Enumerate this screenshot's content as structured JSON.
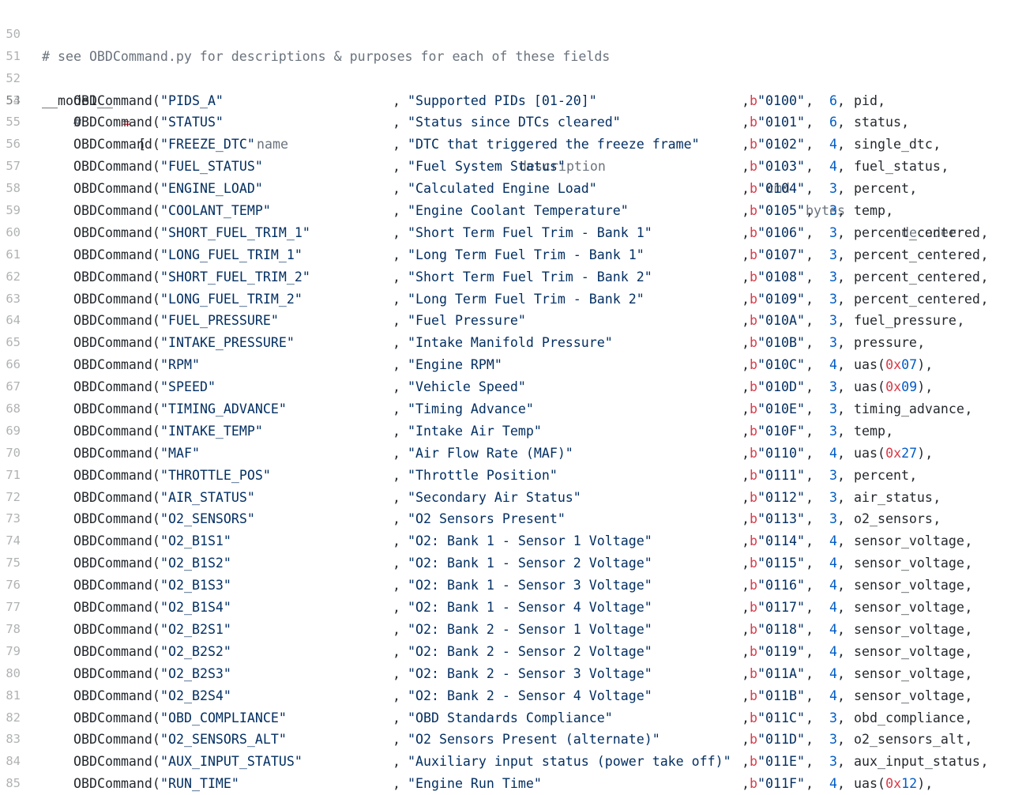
{
  "colors": {
    "comment": "#6a737d",
    "string": "#032f62",
    "number": "#005cc5",
    "keyword": "#d73a49",
    "text": "#24292e",
    "line_number": "#bbbbbb"
  },
  "header_lines": [
    {
      "num": "50",
      "text": "# see OBDCommand.py for descriptions & purposes for each of these fields"
    },
    {
      "num": "51",
      "text": ""
    },
    {
      "num": "52",
      "var": "__mode1__",
      "op": "=",
      "bracket": "["
    }
  ],
  "column_header": {
    "num": "53",
    "hash": "#",
    "name": "name",
    "description": "description",
    "cmd": "cmd",
    "bytes": "bytes",
    "decoder": "decoder"
  },
  "rows": [
    {
      "num": "54",
      "cls": "OBDCommand(",
      "name": "\"PIDS_A\"",
      "desc": "\"Supported PIDs [01-20]\"",
      "b": "b",
      "cmd": "\"0100\"",
      "bytes": "6",
      "dec": "pid",
      "dec_arg": "",
      "tail": ","
    },
    {
      "num": "55",
      "cls": "OBDCommand(",
      "name": "\"STATUS\"",
      "desc": "\"Status since DTCs cleared\"",
      "b": "b",
      "cmd": "\"0101\"",
      "bytes": "6",
      "dec": "status",
      "dec_arg": "",
      "tail": ","
    },
    {
      "num": "56",
      "cls": "OBDCommand(",
      "name": "\"FREEZE_DTC\"",
      "desc": "\"DTC that triggered the freeze frame\"",
      "b": "b",
      "cmd": "\"0102\"",
      "bytes": "4",
      "dec": "single_dtc",
      "dec_arg": "",
      "tail": ","
    },
    {
      "num": "57",
      "cls": "OBDCommand(",
      "name": "\"FUEL_STATUS\"",
      "desc": "\"Fuel System Status\"",
      "b": "b",
      "cmd": "\"0103\"",
      "bytes": "4",
      "dec": "fuel_status",
      "dec_arg": "",
      "tail": ","
    },
    {
      "num": "58",
      "cls": "OBDCommand(",
      "name": "\"ENGINE_LOAD\"",
      "desc": "\"Calculated Engine Load\"",
      "b": "b",
      "cmd": "\"0104\"",
      "bytes": "3",
      "dec": "percent",
      "dec_arg": "",
      "tail": ","
    },
    {
      "num": "59",
      "cls": "OBDCommand(",
      "name": "\"COOLANT_TEMP\"",
      "desc": "\"Engine Coolant Temperature\"",
      "b": "b",
      "cmd": "\"0105\"",
      "bytes": "3",
      "dec": "temp",
      "dec_arg": "",
      "tail": ","
    },
    {
      "num": "60",
      "cls": "OBDCommand(",
      "name": "\"SHORT_FUEL_TRIM_1\"",
      "desc": "\"Short Term Fuel Trim - Bank 1\"",
      "b": "b",
      "cmd": "\"0106\"",
      "bytes": "3",
      "dec": "percent_centered",
      "dec_arg": "",
      "tail": ","
    },
    {
      "num": "61",
      "cls": "OBDCommand(",
      "name": "\"LONG_FUEL_TRIM_1\"",
      "desc": "\"Long Term Fuel Trim - Bank 1\"",
      "b": "b",
      "cmd": "\"0107\"",
      "bytes": "3",
      "dec": "percent_centered",
      "dec_arg": "",
      "tail": ","
    },
    {
      "num": "62",
      "cls": "OBDCommand(",
      "name": "\"SHORT_FUEL_TRIM_2\"",
      "desc": "\"Short Term Fuel Trim - Bank 2\"",
      "b": "b",
      "cmd": "\"0108\"",
      "bytes": "3",
      "dec": "percent_centered",
      "dec_arg": "",
      "tail": ","
    },
    {
      "num": "63",
      "cls": "OBDCommand(",
      "name": "\"LONG_FUEL_TRIM_2\"",
      "desc": "\"Long Term Fuel Trim - Bank 2\"",
      "b": "b",
      "cmd": "\"0109\"",
      "bytes": "3",
      "dec": "percent_centered",
      "dec_arg": "",
      "tail": ","
    },
    {
      "num": "64",
      "cls": "OBDCommand(",
      "name": "\"FUEL_PRESSURE\"",
      "desc": "\"Fuel Pressure\"",
      "b": "b",
      "cmd": "\"010A\"",
      "bytes": "3",
      "dec": "fuel_pressure",
      "dec_arg": "",
      "tail": ","
    },
    {
      "num": "65",
      "cls": "OBDCommand(",
      "name": "\"INTAKE_PRESSURE\"",
      "desc": "\"Intake Manifold Pressure\"",
      "b": "b",
      "cmd": "\"010B\"",
      "bytes": "3",
      "dec": "pressure",
      "dec_arg": "",
      "tail": ","
    },
    {
      "num": "66",
      "cls": "OBDCommand(",
      "name": "\"RPM\"",
      "desc": "\"Engine RPM\"",
      "b": "b",
      "cmd": "\"010C\"",
      "bytes": "4",
      "dec": "uas(",
      "dec_arg": "07",
      "tail": "),"
    },
    {
      "num": "67",
      "cls": "OBDCommand(",
      "name": "\"SPEED\"",
      "desc": "\"Vehicle Speed\"",
      "b": "b",
      "cmd": "\"010D\"",
      "bytes": "3",
      "dec": "uas(",
      "dec_arg": "09",
      "tail": "),"
    },
    {
      "num": "68",
      "cls": "OBDCommand(",
      "name": "\"TIMING_ADVANCE\"",
      "desc": "\"Timing Advance\"",
      "b": "b",
      "cmd": "\"010E\"",
      "bytes": "3",
      "dec": "timing_advance",
      "dec_arg": "",
      "tail": ","
    },
    {
      "num": "69",
      "cls": "OBDCommand(",
      "name": "\"INTAKE_TEMP\"",
      "desc": "\"Intake Air Temp\"",
      "b": "b",
      "cmd": "\"010F\"",
      "bytes": "3",
      "dec": "temp",
      "dec_arg": "",
      "tail": ","
    },
    {
      "num": "70",
      "cls": "OBDCommand(",
      "name": "\"MAF\"",
      "desc": "\"Air Flow Rate (MAF)\"",
      "b": "b",
      "cmd": "\"0110\"",
      "bytes": "4",
      "dec": "uas(",
      "dec_arg": "27",
      "tail": "),"
    },
    {
      "num": "71",
      "cls": "OBDCommand(",
      "name": "\"THROTTLE_POS\"",
      "desc": "\"Throttle Position\"",
      "b": "b",
      "cmd": "\"0111\"",
      "bytes": "3",
      "dec": "percent",
      "dec_arg": "",
      "tail": ","
    },
    {
      "num": "72",
      "cls": "OBDCommand(",
      "name": "\"AIR_STATUS\"",
      "desc": "\"Secondary Air Status\"",
      "b": "b",
      "cmd": "\"0112\"",
      "bytes": "3",
      "dec": "air_status",
      "dec_arg": "",
      "tail": ","
    },
    {
      "num": "73",
      "cls": "OBDCommand(",
      "name": "\"O2_SENSORS\"",
      "desc": "\"O2 Sensors Present\"",
      "b": "b",
      "cmd": "\"0113\"",
      "bytes": "3",
      "dec": "o2_sensors",
      "dec_arg": "",
      "tail": ","
    },
    {
      "num": "74",
      "cls": "OBDCommand(",
      "name": "\"O2_B1S1\"",
      "desc": "\"O2: Bank 1 - Sensor 1 Voltage\"",
      "b": "b",
      "cmd": "\"0114\"",
      "bytes": "4",
      "dec": "sensor_voltage",
      "dec_arg": "",
      "tail": ","
    },
    {
      "num": "75",
      "cls": "OBDCommand(",
      "name": "\"O2_B1S2\"",
      "desc": "\"O2: Bank 1 - Sensor 2 Voltage\"",
      "b": "b",
      "cmd": "\"0115\"",
      "bytes": "4",
      "dec": "sensor_voltage",
      "dec_arg": "",
      "tail": ","
    },
    {
      "num": "76",
      "cls": "OBDCommand(",
      "name": "\"O2_B1S3\"",
      "desc": "\"O2: Bank 1 - Sensor 3 Voltage\"",
      "b": "b",
      "cmd": "\"0116\"",
      "bytes": "4",
      "dec": "sensor_voltage",
      "dec_arg": "",
      "tail": ","
    },
    {
      "num": "77",
      "cls": "OBDCommand(",
      "name": "\"O2_B1S4\"",
      "desc": "\"O2: Bank 1 - Sensor 4 Voltage\"",
      "b": "b",
      "cmd": "\"0117\"",
      "bytes": "4",
      "dec": "sensor_voltage",
      "dec_arg": "",
      "tail": ","
    },
    {
      "num": "78",
      "cls": "OBDCommand(",
      "name": "\"O2_B2S1\"",
      "desc": "\"O2: Bank 2 - Sensor 1 Voltage\"",
      "b": "b",
      "cmd": "\"0118\"",
      "bytes": "4",
      "dec": "sensor_voltage",
      "dec_arg": "",
      "tail": ","
    },
    {
      "num": "79",
      "cls": "OBDCommand(",
      "name": "\"O2_B2S2\"",
      "desc": "\"O2: Bank 2 - Sensor 2 Voltage\"",
      "b": "b",
      "cmd": "\"0119\"",
      "bytes": "4",
      "dec": "sensor_voltage",
      "dec_arg": "",
      "tail": ","
    },
    {
      "num": "80",
      "cls": "OBDCommand(",
      "name": "\"O2_B2S3\"",
      "desc": "\"O2: Bank 2 - Sensor 3 Voltage\"",
      "b": "b",
      "cmd": "\"011A\"",
      "bytes": "4",
      "dec": "sensor_voltage",
      "dec_arg": "",
      "tail": ","
    },
    {
      "num": "81",
      "cls": "OBDCommand(",
      "name": "\"O2_B2S4\"",
      "desc": "\"O2: Bank 2 - Sensor 4 Voltage\"",
      "b": "b",
      "cmd": "\"011B\"",
      "bytes": "4",
      "dec": "sensor_voltage",
      "dec_arg": "",
      "tail": ","
    },
    {
      "num": "82",
      "cls": "OBDCommand(",
      "name": "\"OBD_COMPLIANCE\"",
      "desc": "\"OBD Standards Compliance\"",
      "b": "b",
      "cmd": "\"011C\"",
      "bytes": "3",
      "dec": "obd_compliance",
      "dec_arg": "",
      "tail": ","
    },
    {
      "num": "83",
      "cls": "OBDCommand(",
      "name": "\"O2_SENSORS_ALT\"",
      "desc": "\"O2 Sensors Present (alternate)\"",
      "b": "b",
      "cmd": "\"011D\"",
      "bytes": "3",
      "dec": "o2_sensors_alt",
      "dec_arg": "",
      "tail": ","
    },
    {
      "num": "84",
      "cls": "OBDCommand(",
      "name": "\"AUX_INPUT_STATUS\"",
      "desc": "\"Auxiliary input status (power take off)\"",
      "b": "b",
      "cmd": "\"011E\"",
      "bytes": "3",
      "dec": "aux_input_status",
      "dec_arg": "",
      "tail": ","
    },
    {
      "num": "85",
      "cls": "OBDCommand(",
      "name": "\"RUN_TIME\"",
      "desc": "\"Engine Run Time\"",
      "b": "b",
      "cmd": "\"011F\"",
      "bytes": "4",
      "dec": "uas(",
      "dec_arg": "12",
      "tail": "),"
    }
  ],
  "tokens": {
    "comma": ",",
    "hex_prefix": "0x"
  }
}
